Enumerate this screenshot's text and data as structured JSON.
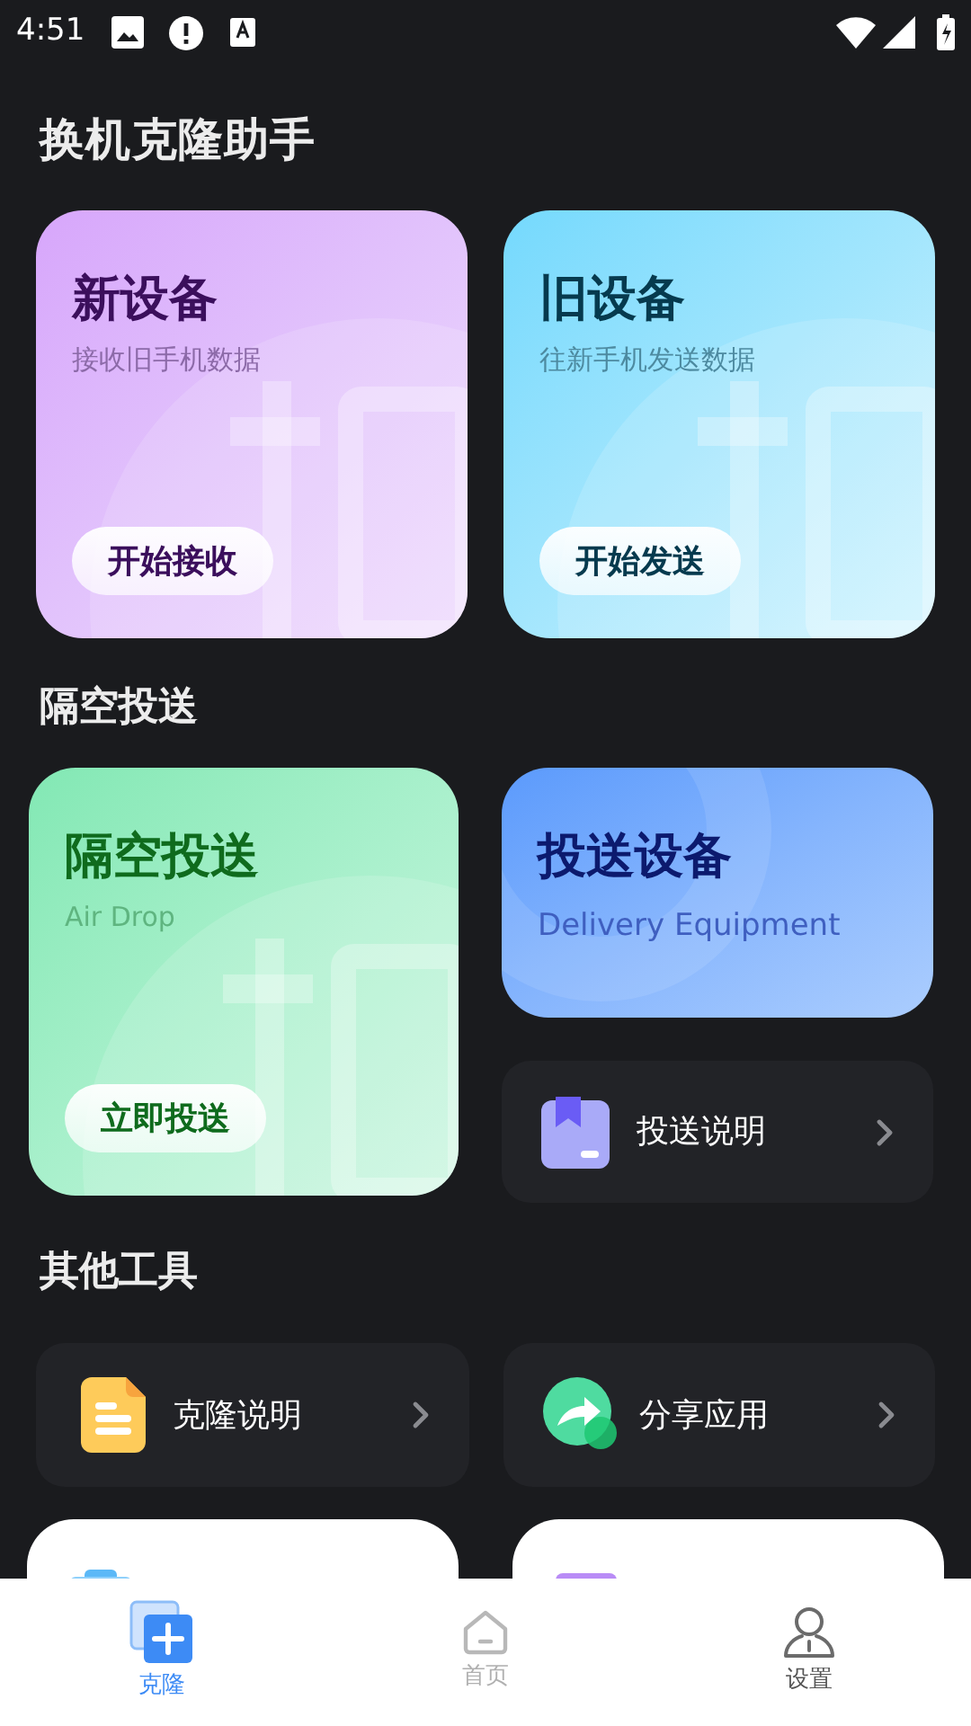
{
  "status_bar": {
    "time": "4:51"
  },
  "title": "换机克隆助手",
  "primary_cards": [
    {
      "kind": "receive",
      "title": "新设备",
      "subtitle": "接收旧手机数据",
      "button": "开始接收"
    },
    {
      "kind": "send",
      "title": "旧设备",
      "subtitle": "往新手机发送数据",
      "button": "开始发送"
    }
  ],
  "airdrop_heading": "隔空投送",
  "airdrop_card": {
    "title": "隔空投送",
    "subtitle": "Air Drop",
    "button": "立即投送"
  },
  "delivery_card": {
    "title": "投送设备",
    "subtitle": "Delivery Equipment"
  },
  "delivery_info": {
    "label": "投送说明"
  },
  "tools_heading": "其他工具",
  "tools": [
    {
      "kind": "doc",
      "label": "克隆说明"
    },
    {
      "kind": "share",
      "label": "分享应用"
    }
  ],
  "bottom_nav": [
    {
      "kind": "clone",
      "label": "克隆",
      "selected": true
    },
    {
      "kind": "home",
      "label": "首页",
      "selected": false
    },
    {
      "kind": "settings",
      "label": "设置",
      "selected": false
    }
  ]
}
